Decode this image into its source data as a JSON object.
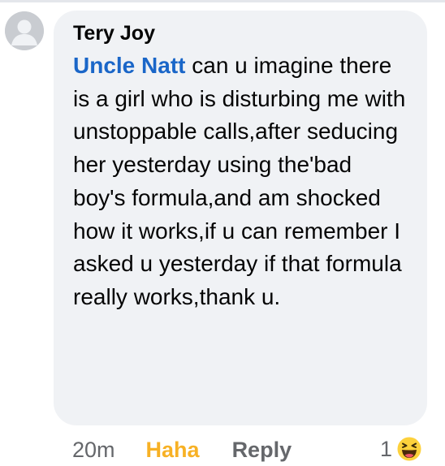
{
  "comment": {
    "author": "Tery Joy",
    "mention": "Uncle Natt",
    "text": " can u imagine there is a girl who is disturbing me with unstoppable calls,after seducing her yesterday using the'bad boy's formula,and am shocked how it works,if u can remember I asked u yesterday if that formula really works,thank u.",
    "time": "20m",
    "reaction_label": "Haha",
    "reply_label": "Reply",
    "reaction_count": "1",
    "reaction_icon": "haha-emoji-icon",
    "colors": {
      "bubble": "#f0f2f5",
      "mention": "#1a66c8",
      "haha": "#f7b125",
      "meta": "#65676b"
    }
  }
}
